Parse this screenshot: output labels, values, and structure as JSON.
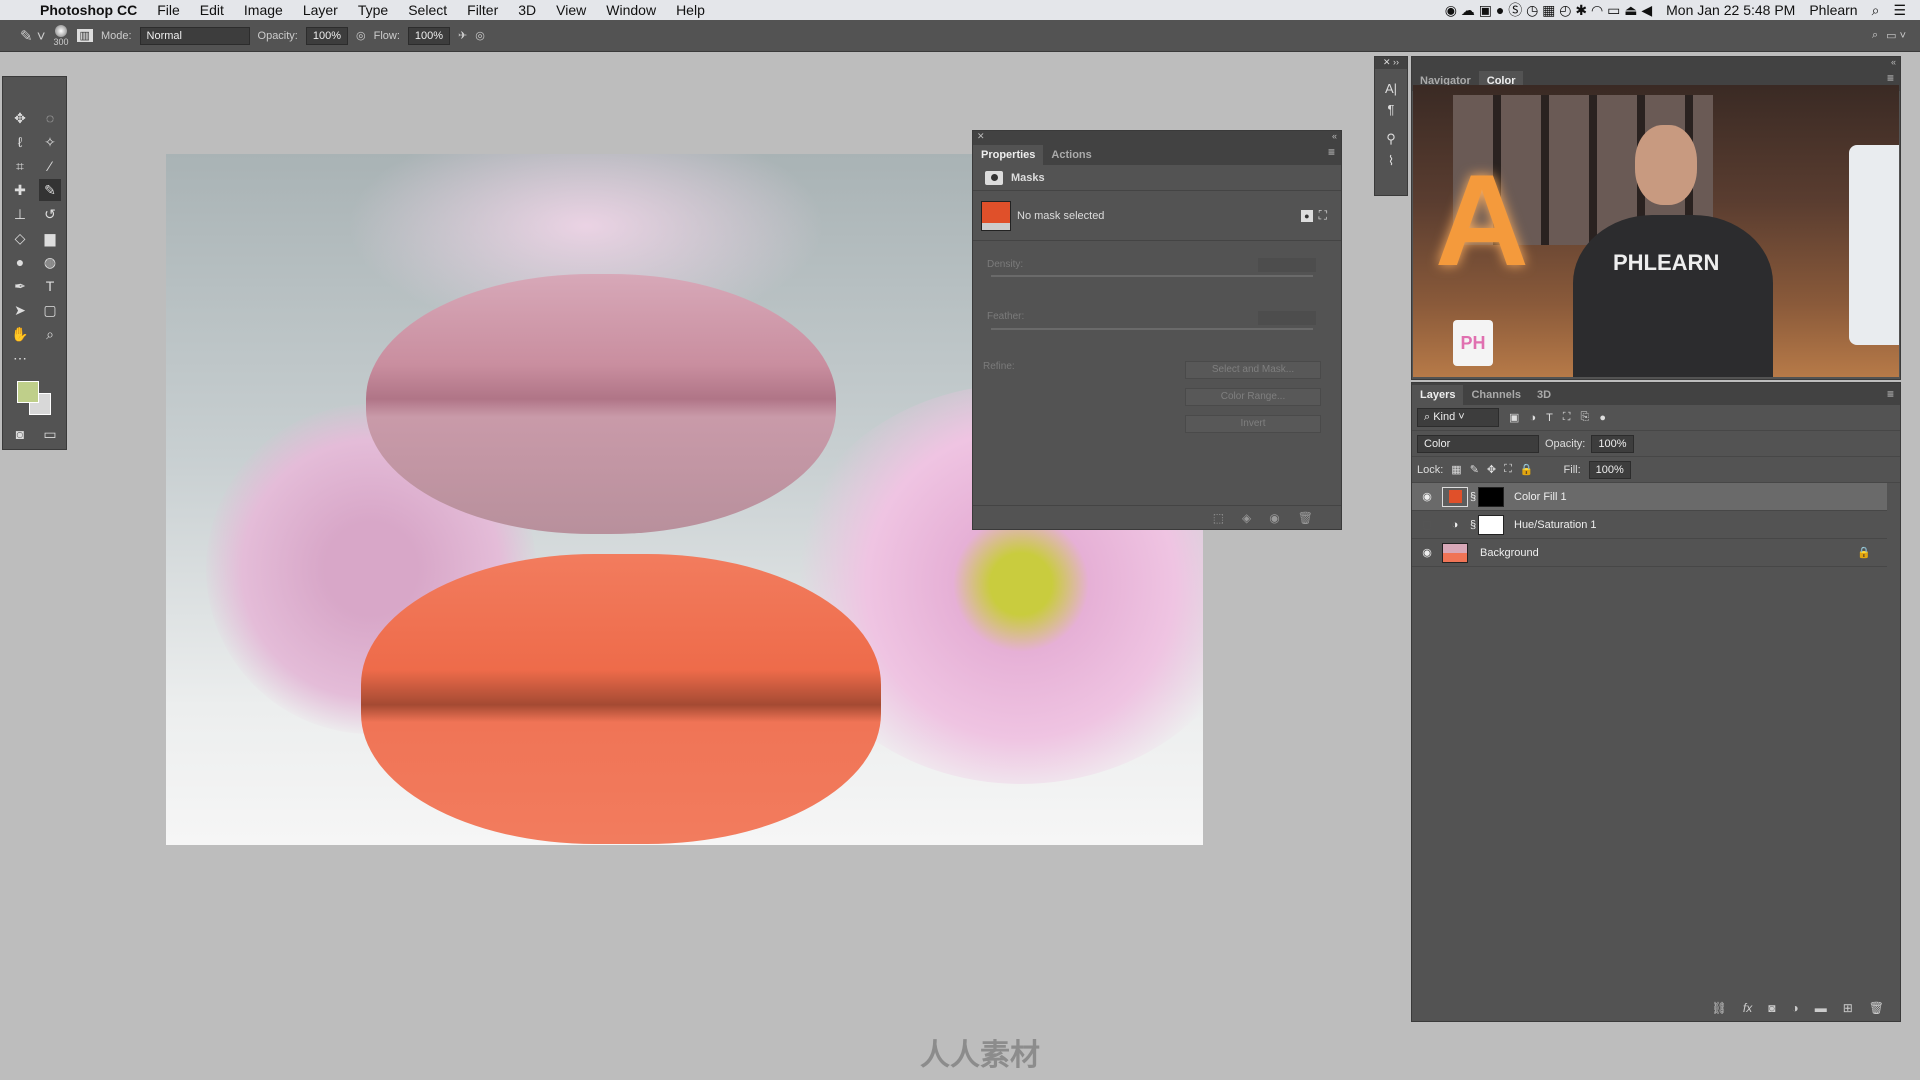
{
  "menubar": {
    "app": "Photoshop CC",
    "items": [
      "File",
      "Edit",
      "Image",
      "Layer",
      "Type",
      "Select",
      "Filter",
      "3D",
      "View",
      "Window",
      "Help"
    ],
    "clock": "Mon Jan 22  5:48 PM",
    "user": "Phlearn"
  },
  "options": {
    "brush_size": "300",
    "mode_label": "Mode:",
    "mode_value": "Normal",
    "opacity_label": "Opacity:",
    "opacity_value": "100%",
    "flow_label": "Flow:",
    "flow_value": "100%"
  },
  "properties": {
    "tabs": [
      "Properties",
      "Actions"
    ],
    "section": "Masks",
    "status": "No mask selected",
    "density_label": "Density:",
    "feather_label": "Feather:",
    "refine_label": "Refine:",
    "buttons": [
      "Select and Mask...",
      "Color Range...",
      "Invert"
    ],
    "fill_color": "#e0502a"
  },
  "navigator": {
    "tabs": [
      "Navigator",
      "Color"
    ],
    "shirt_text": "PHLEARN",
    "sign_letter": "A",
    "mug_text": "PH"
  },
  "layers": {
    "tabs": [
      "Layers",
      "Channels",
      "3D"
    ],
    "filter": "Kind",
    "blend_mode": "Color",
    "opacity_label": "Opacity:",
    "opacity_value": "100%",
    "lock_label": "Lock:",
    "fill_label": "Fill:",
    "fill_value": "100%",
    "items": [
      {
        "name": "Color Fill 1",
        "visible": true,
        "selected": true
      },
      {
        "name": "Hue/Saturation 1",
        "visible": false,
        "selected": false
      },
      {
        "name": "Background",
        "visible": true,
        "selected": false,
        "locked": true
      }
    ]
  },
  "colors": {
    "foreground": "#bfcf8a",
    "background": "#d8d8d8",
    "accent": "#e0502a"
  },
  "watermark": "人人素材"
}
